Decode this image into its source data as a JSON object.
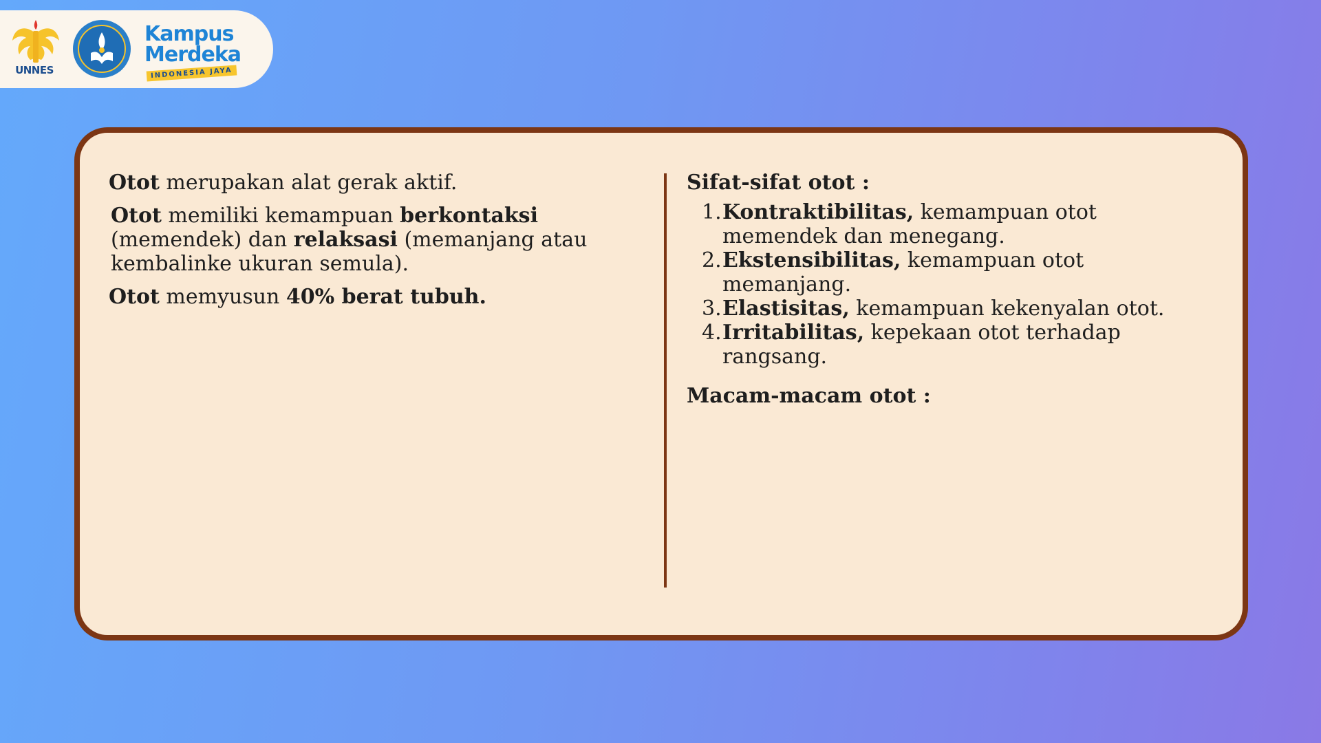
{
  "header": {
    "unnes_label": "UNNES",
    "kampus_merdeka_line1": "Kampus",
    "kampus_merdeka_line2": "Merdeka",
    "kampus_merdeka_tagline": "INDONESIA JAYA"
  },
  "left_column": {
    "paragraphs": [
      {
        "bold": "Otot",
        "rest": " merupakan alat gerak aktif."
      },
      {
        "bold": "Otot",
        "part2": " memiliki kemampuan ",
        "bold2": "berkontaksi",
        "part3": " (memendek) dan ",
        "bold3": "relaksasi",
        "part4": " (memanjang atau kembalinke ukuran semula)."
      },
      {
        "bold": "Otot",
        "rest": " memyusun ",
        "bold2": "40% berat tubuh."
      }
    ]
  },
  "right_column": {
    "sifat_heading": "Sifat-sifat otot :",
    "sifat_items": [
      {
        "num": "1.",
        "term": "Kontraktibilitas,",
        "desc": " kemampuan otot memendek dan menegang."
      },
      {
        "num": "2.",
        "term": "Ekstensibilitas,",
        "desc": " kemampuan otot memanjang."
      },
      {
        "num": "3.",
        "term": "Elastisitas,",
        "desc": " kemampuan kekenyalan otot."
      },
      {
        "num": "4.",
        "term": "Irritabilitas,",
        "desc": " kepekaan otot terhadap rangsang."
      }
    ],
    "macam_heading": "Macam-macam otot :"
  },
  "colors": {
    "card_background": "#fae9d4",
    "card_border": "#7c3614",
    "text": "#1e1e1e"
  }
}
